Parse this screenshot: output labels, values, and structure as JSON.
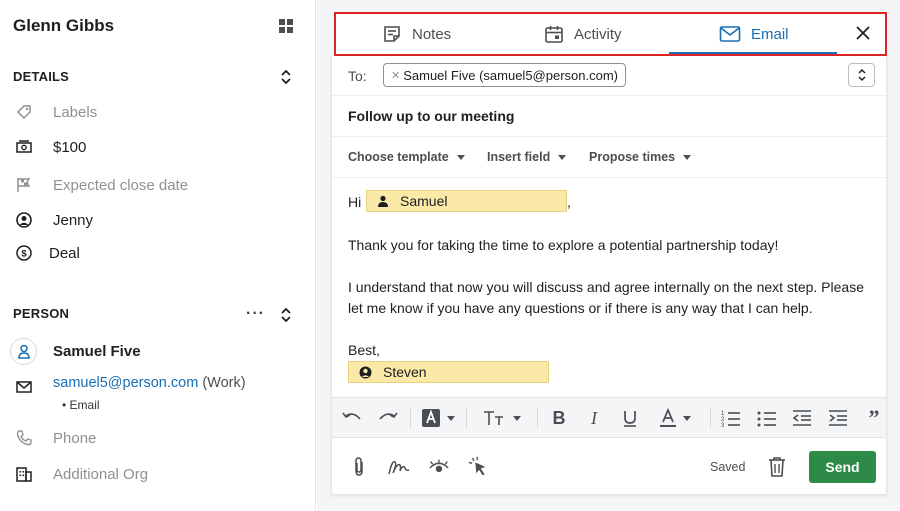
{
  "deal": {
    "title": "Glenn Gibbs"
  },
  "details": {
    "heading": "DETAILS",
    "labels_placeholder": "Labels",
    "value": "$100",
    "expected_close_placeholder": "Expected close date",
    "owner": "Jenny",
    "type": "Deal"
  },
  "person": {
    "heading": "PERSON",
    "more": "···",
    "name": "Samuel Five",
    "email": "samuel5@person.com",
    "email_type": "(Work)",
    "email_sub": "Email",
    "phone_placeholder": "Phone",
    "org_placeholder": "Additional Org"
  },
  "tabs": [
    {
      "label": "Notes",
      "icon": "notes-icon"
    },
    {
      "label": "Activity",
      "icon": "calendar-icon"
    },
    {
      "label": "Email",
      "icon": "mail-icon",
      "active": true
    }
  ],
  "email": {
    "to_label": "To:",
    "recipient": "Samuel Five (samuel5@person.com)",
    "subject": "Follow up to our meeting",
    "options": [
      "Choose template",
      "Insert field",
      "Propose times"
    ],
    "greeting": "Hi",
    "greeting_field": "Samuel",
    "greeting_comma": ",",
    "para1": "Thank you for taking the time to explore a potential partnership today!",
    "para2_line1": "I understand that now you will discuss and agree internally on the next step. Please",
    "para2_line2": "let me know if you have any questions or if there is any way that I can help.",
    "signoff": "Best,",
    "sender_field": "Steven",
    "status": "Saved",
    "send_label": "Send"
  },
  "colors": {
    "accent_blue": "#1a6fb3",
    "send_green": "#2e8b47",
    "merge_yellow": "#fbe9a7",
    "highlight_red": "#e02424"
  }
}
